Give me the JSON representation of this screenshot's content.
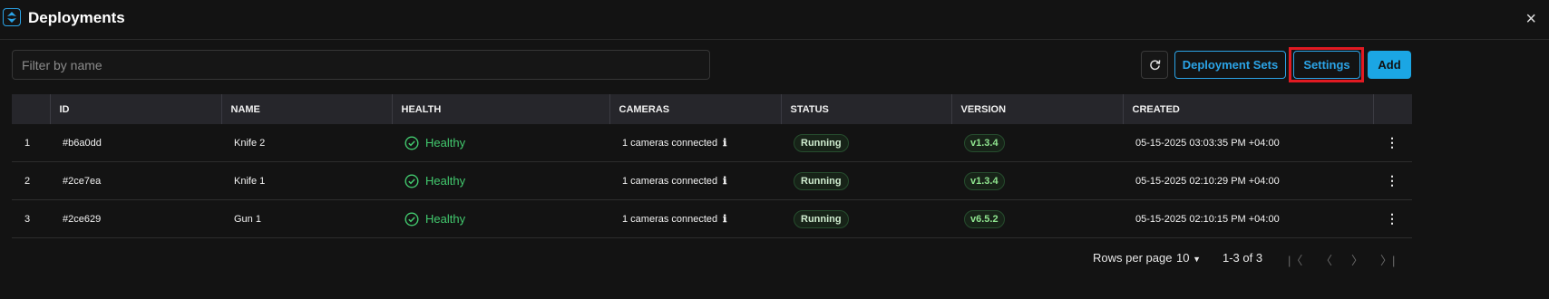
{
  "header": {
    "title": "Deployments",
    "close_glyph": "×"
  },
  "toolbar": {
    "filter_placeholder": "Filter by name",
    "deployment_sets_label": "Deployment Sets",
    "settings_label": "Settings",
    "add_label": "Add",
    "highlight_color": "#e11a22",
    "accent_color": "#2ba3e6"
  },
  "table": {
    "columns": [
      "",
      "ID",
      "NAME",
      "HEALTH",
      "CAMERAS",
      "STATUS",
      "VERSION",
      "CREATED",
      ""
    ],
    "rows": [
      {
        "index": "1",
        "id": "#b6a0dd",
        "name": "Knife 2",
        "health": "Healthy",
        "cameras": "1 cameras connected",
        "status": "Running",
        "version": "v1.3.4",
        "created": "05-15-2025 03:03:35 PM +04:00"
      },
      {
        "index": "2",
        "id": "#2ce7ea",
        "name": "Knife 1",
        "health": "Healthy",
        "cameras": "1 cameras connected",
        "status": "Running",
        "version": "v1.3.4",
        "created": "05-15-2025 02:10:29 PM +04:00"
      },
      {
        "index": "3",
        "id": "#2ce629",
        "name": "Gun 1",
        "health": "Healthy",
        "cameras": "1 cameras connected",
        "status": "Running",
        "version": "v6.5.2",
        "created": "05-15-2025 02:10:15 PM +04:00"
      }
    ]
  },
  "pagination": {
    "rows_per_page_label": "Rows per page",
    "rows_per_page_value": "10",
    "range": "1-3 of 3",
    "first_glyph": "|〈",
    "prev_glyph": "〈",
    "next_glyph": "〉",
    "last_glyph": "〉|"
  },
  "icons": {
    "logo": "deployment-logo-icon",
    "refresh": "refresh-icon",
    "healthy": "check-circle-icon",
    "info": "info-icon",
    "row_menu": "kebab-menu-icon",
    "dropdown": "caret-down-icon"
  }
}
